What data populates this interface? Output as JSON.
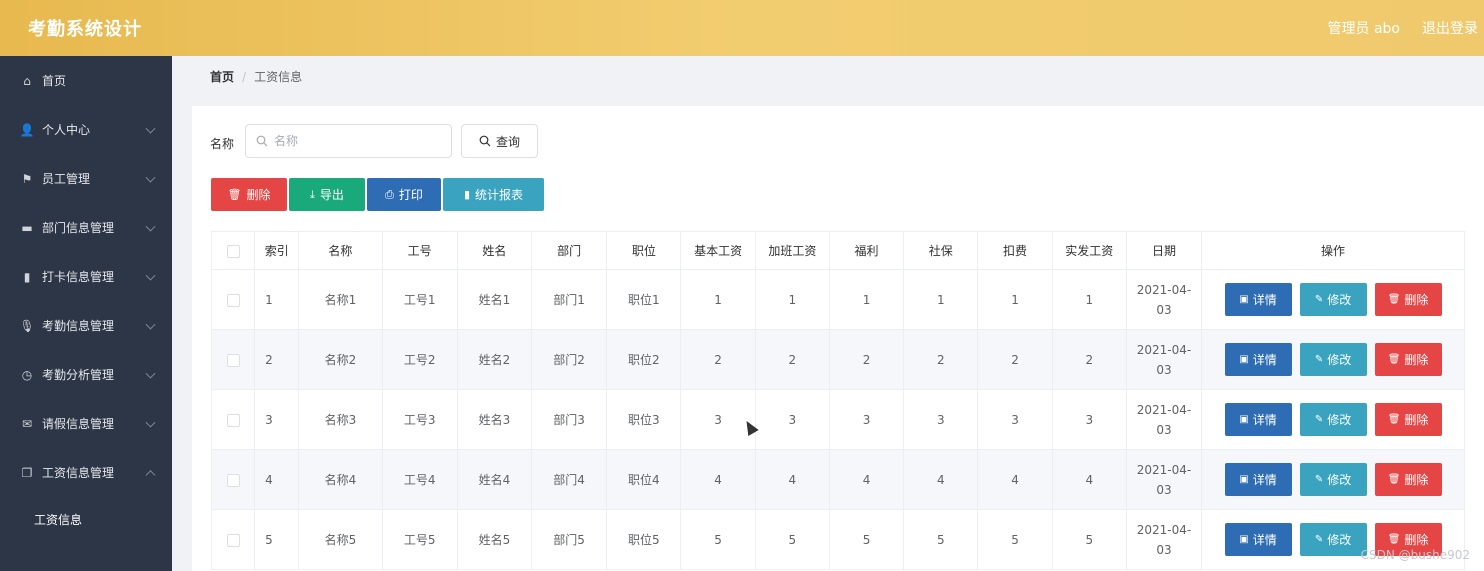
{
  "header": {
    "title": "考勤系统设计",
    "user": "管理员 abo",
    "logout": "退出登录"
  },
  "sidebar": {
    "items": [
      {
        "label": "首页",
        "icon": "home-icon",
        "glyph": "⌂",
        "has_arrow": false
      },
      {
        "label": "个人中心",
        "icon": "user-icon",
        "glyph": "👤",
        "has_arrow": true
      },
      {
        "label": "员工管理",
        "icon": "flag-icon",
        "glyph": "⚑",
        "has_arrow": true
      },
      {
        "label": "部门信息管理",
        "icon": "briefcase-icon",
        "glyph": "▬",
        "has_arrow": true
      },
      {
        "label": "打卡信息管理",
        "icon": "bar-chart-icon",
        "glyph": "▮",
        "has_arrow": true
      },
      {
        "label": "考勤信息管理",
        "icon": "microphone-icon",
        "glyph": "🎙",
        "has_arrow": true
      },
      {
        "label": "考勤分析管理",
        "icon": "clock-icon",
        "glyph": "◷",
        "has_arrow": true
      },
      {
        "label": "请假信息管理",
        "icon": "mail-icon",
        "glyph": "✉",
        "has_arrow": true
      },
      {
        "label": "工资信息管理",
        "icon": "copy-icon",
        "glyph": "❐",
        "has_arrow": true,
        "expanded": true
      }
    ],
    "submenu": [
      "工资信息"
    ]
  },
  "breadcrumb": {
    "home": "首页",
    "separator": "/",
    "current": "工资信息"
  },
  "search": {
    "label": "名称",
    "placeholder": "名称",
    "button": "查询"
  },
  "actions": {
    "delete": "删除",
    "export": "导出",
    "print": "打印",
    "report": "统计报表"
  },
  "table": {
    "headers": [
      "索引",
      "名称",
      "工号",
      "姓名",
      "部门",
      "职位",
      "基本工资",
      "加班工资",
      "福利",
      "社保",
      "扣费",
      "实发工资",
      "日期",
      "操作"
    ],
    "rows": [
      [
        "1",
        "名称1",
        "工号1",
        "姓名1",
        "部门1",
        "职位1",
        "1",
        "1",
        "1",
        "1",
        "1",
        "1",
        "2021-04-",
        "03"
      ],
      [
        "2",
        "名称2",
        "工号2",
        "姓名2",
        "部门2",
        "职位2",
        "2",
        "2",
        "2",
        "2",
        "2",
        "2",
        "2021-04-",
        "03"
      ],
      [
        "3",
        "名称3",
        "工号3",
        "姓名3",
        "部门3",
        "职位3",
        "3",
        "3",
        "3",
        "3",
        "3",
        "3",
        "2021-04-",
        "03"
      ],
      [
        "4",
        "名称4",
        "工号4",
        "姓名4",
        "部门4",
        "职位4",
        "4",
        "4",
        "4",
        "4",
        "4",
        "4",
        "2021-04-",
        "03"
      ],
      [
        "5",
        "名称5",
        "工号5",
        "姓名5",
        "部门5",
        "职位5",
        "5",
        "5",
        "5",
        "5",
        "5",
        "5",
        "2021-04-",
        "03"
      ]
    ],
    "row_ops": {
      "detail": "详情",
      "edit": "修改",
      "delete": "删除"
    }
  },
  "watermark": "CSDN @bushe902",
  "colors": {
    "header": "#f0c762",
    "sidebar": "#2d3647",
    "danger": "#e54545",
    "success": "#19a97a",
    "primary": "#2e6db3",
    "info": "#3aa3c0"
  }
}
